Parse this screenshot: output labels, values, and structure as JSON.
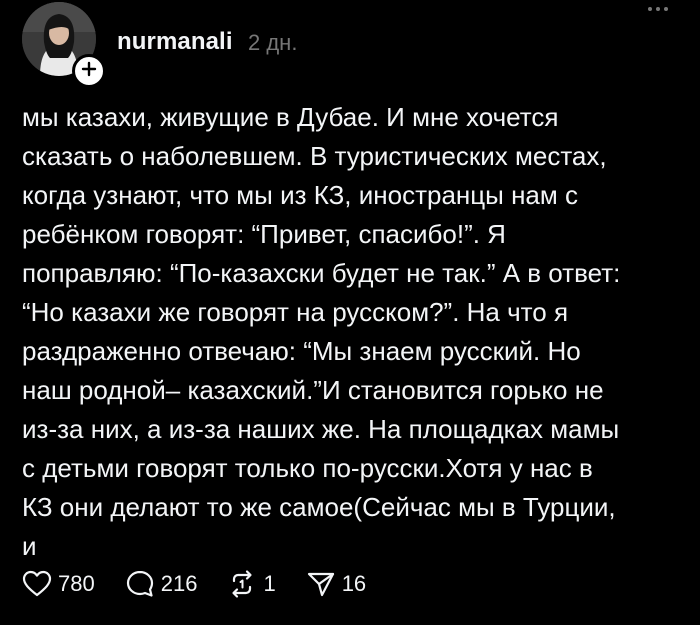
{
  "post": {
    "author": {
      "username": "nurmanali",
      "avatar_icon": "user-avatar-photo",
      "follow_icon": "plus-icon"
    },
    "timestamp": "2 дн.",
    "more_icon": "more-horizontal-icon",
    "text": "мы казахи, живущие в Дубае. И мне хочется\nсказать о наболевшем. В туристических местах,\nкогда узнают, что мы из КЗ, иностранцы нам с\nребёнком говорят: “Привет, спасибо!”. Я\nпоправляю: “По-казахски будет не так.” А в ответ:\n“Но казахи же говорят на русском?”. На что я\nраздраженно отвечаю: “Мы знаем русский. Но\nнаш родной– казахский.”И становится горько не\nиз-за них, а из-за наших же. На площадках мамы\nс детьми говорят только по-русски.Хотя у нас в\nКЗ они делают то же самое(Сейчас мы в Турции,\nи",
    "actions": {
      "likes": {
        "icon": "heart-icon",
        "count": "780"
      },
      "comments": {
        "icon": "comment-icon",
        "count": "216"
      },
      "reposts": {
        "icon": "repost-icon",
        "count": "1"
      },
      "shares": {
        "icon": "send-icon",
        "count": "16"
      }
    }
  },
  "colors": {
    "background": "#000000",
    "text": "#f3f5f7",
    "muted": "#777777"
  }
}
